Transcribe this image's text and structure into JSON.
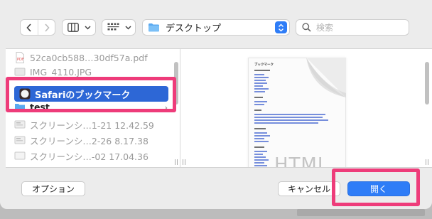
{
  "toolbar": {
    "location": "デスクトップ",
    "search_placeholder": "検索"
  },
  "sidebar": {
    "items": [
      {
        "name": "52ca0cb588…30df57a.pdf"
      },
      {
        "name": "IMG_4110.JPG"
      },
      {
        "name": "Safariのブックマーク"
      },
      {
        "name": "test"
      },
      {
        "name": "スクリーンシ…1-21 12.42.59"
      },
      {
        "name": "スクリーンシ…2-26 8.17.38"
      },
      {
        "name": "スクリーンシ…-02 17.04.36"
      }
    ]
  },
  "preview": {
    "doc_title": "ブックマーク",
    "watermark": "HTML"
  },
  "buttons": {
    "options": "オプション",
    "cancel": "キャンセル",
    "open": "開く"
  },
  "colors": {
    "accent": "#2f7df7",
    "selection": "#2d67d6",
    "highlight": "#ee3c7a"
  }
}
